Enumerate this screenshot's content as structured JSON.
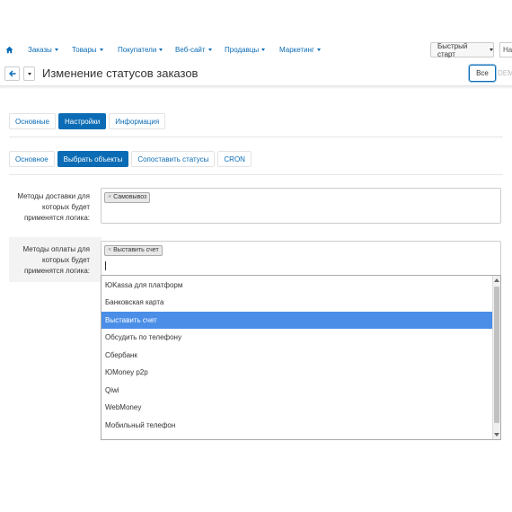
{
  "nav": {
    "items": [
      {
        "label": "Заказы"
      },
      {
        "label": "Товары"
      },
      {
        "label": "Покупатели"
      },
      {
        "label": "Веб-сайт"
      },
      {
        "label": "Продавцы"
      },
      {
        "label": "Маркетинг"
      }
    ],
    "quick_start": "Быстрый старт",
    "search_stub": "Най"
  },
  "header": {
    "title": "Изменение статусов заказов",
    "all_button": "Все",
    "hidden_text": "DEM"
  },
  "tabs_main": [
    {
      "label": "Основные",
      "active": false
    },
    {
      "label": "Настройки",
      "active": true
    },
    {
      "label": "Информация",
      "active": false
    }
  ],
  "tabs_sub": [
    {
      "label": "Основное",
      "active": false
    },
    {
      "label": "Выбрать объекты",
      "active": true
    },
    {
      "label": "Сопоставить статусы",
      "active": false
    },
    {
      "label": "CRON",
      "active": false
    }
  ],
  "delivery": {
    "label_lines": [
      "Методы доставки для",
      "которых будет",
      "применятся логика:"
    ],
    "chip": "Самовывоз"
  },
  "payment": {
    "label_lines": [
      "Методы оплаты для",
      "которых будет",
      "применятся логика:"
    ],
    "chip": "Выставить счет"
  },
  "dropdown": {
    "options": [
      {
        "label": "ЮKassa для платформ",
        "selected": false
      },
      {
        "label": "Банковская карта",
        "selected": false
      },
      {
        "label": "Выставить счет",
        "selected": true
      },
      {
        "label": "Обсудить по телефону",
        "selected": false
      },
      {
        "label": "Сбербанк",
        "selected": false
      },
      {
        "label": "ЮMoney p2p",
        "selected": false
      },
      {
        "label": "Qiwi",
        "selected": false
      },
      {
        "label": "WebMoney",
        "selected": false
      },
      {
        "label": "Мобильный телефон",
        "selected": false
      }
    ]
  },
  "colors": {
    "accent": "#0b6cb5",
    "selected_option": "#4a8ee8"
  }
}
